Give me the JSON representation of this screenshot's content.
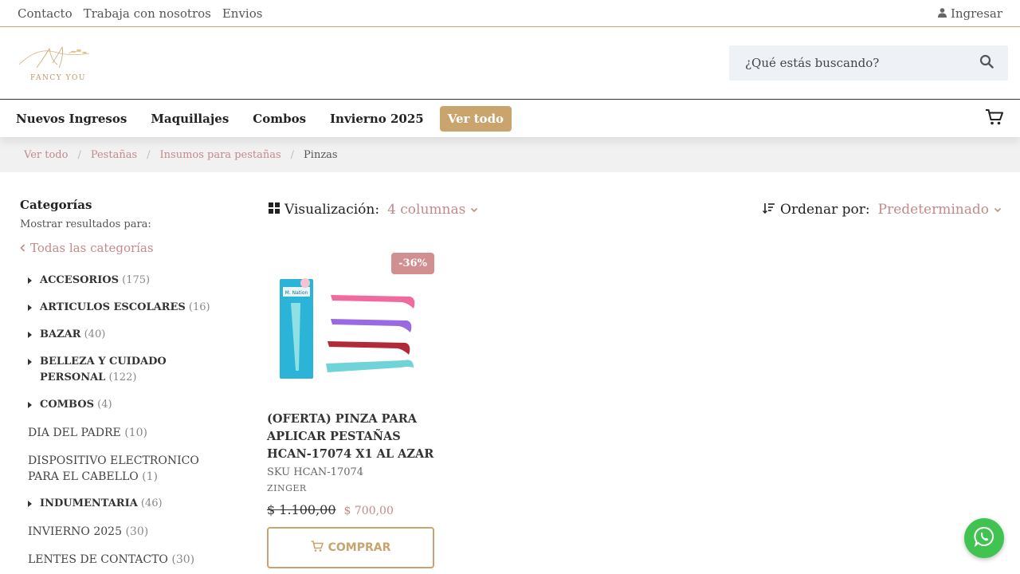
{
  "topbar": {
    "links": [
      "Contacto",
      "Trabaja con nosotros",
      "Envios"
    ],
    "login_label": "Ingresar"
  },
  "header": {
    "logo_text": "FANCY YOU",
    "search_placeholder": "¿Qué estás buscando?"
  },
  "nav": {
    "items": [
      "Nuevos Ingresos",
      "Maquillajes",
      "Combos",
      "Invierno 2025"
    ],
    "see_all": "Ver todo"
  },
  "breadcrumb": {
    "crumbs": [
      "Ver todo",
      "Pestañas",
      "Insumos para pestañas"
    ],
    "current": "Pinzas",
    "separator": "/"
  },
  "sidebar": {
    "title": "Categorías",
    "subtitle": "Mostrar resultados para:",
    "all_categories": "Todas las categorías",
    "categories": [
      {
        "name": "ACCESORIOS",
        "count": "(175)"
      },
      {
        "name": "ARTICULOS ESCOLARES",
        "count": "(16)"
      },
      {
        "name": "BAZAR",
        "count": "(40)"
      },
      {
        "name": "BELLEZA Y CUIDADO PERSONAL",
        "count": "(122)"
      },
      {
        "name": "COMBOS",
        "count": "(4)"
      },
      {
        "name": "DIA DEL PADRE",
        "count": "(10)"
      },
      {
        "name": "DISPOSITIVO ELECTRONICO PARA EL CABELLO",
        "count": "(1)"
      },
      {
        "name": "INDUMENTARIA",
        "count": "(46)"
      },
      {
        "name": "INVIERNO 2025",
        "count": "(30)"
      },
      {
        "name": "LENTES DE CONTACTO",
        "count": "(30)"
      }
    ]
  },
  "toolbar": {
    "view_label": "Visualización:",
    "view_value": "4 columnas",
    "sort_label": "Ordenar por:",
    "sort_value": "Predeterminado"
  },
  "product": {
    "badge": "-36%",
    "name": "(OFERTA) PINZA PARA APLICAR PESTAÑAS HCAN-17074 X1 AL AZAR",
    "sku": "SKU HCAN-17074",
    "brand": "ZINGER",
    "old_price": "$ 1.100,00",
    "new_price": "$ 700,00",
    "buy_label": "COMPRAR",
    "package_text": "M. Nation",
    "tweezer_colors": [
      "#f06aa0",
      "#9a6ae0",
      "#b02a3a",
      "#6fd3d8"
    ]
  },
  "colors": {
    "accent_gold": "#c9a56d",
    "accent_rose": "#c48a8a",
    "whatsapp": "#41c352"
  }
}
